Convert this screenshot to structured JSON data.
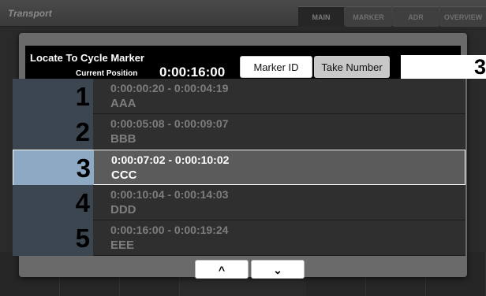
{
  "app": {
    "title": "Transport",
    "tabs": [
      "MAIN",
      "MARKER",
      "ADR",
      "OVERVIEW"
    ],
    "active_tab": "MAIN"
  },
  "dialog": {
    "title": "Locate To Cycle Marker",
    "current_position_label": "Current Position",
    "current_position_value": "0:00:16:00",
    "marker_id_label": "Marker ID",
    "take_number_label": "Take Number",
    "input_value": "3"
  },
  "markers": [
    {
      "id": "1",
      "range": "0:00:00:20 - 0:00:04:19",
      "name": "AAA",
      "selected": false
    },
    {
      "id": "2",
      "range": "0:00:05:08 - 0:00:09:07",
      "name": "BBB",
      "selected": false
    },
    {
      "id": "3",
      "range": "0:00:07:02 - 0:00:10:02",
      "name": "CCC",
      "selected": true
    },
    {
      "id": "4",
      "range": "0:00:10:04 - 0:00:14:03",
      "name": "DDD",
      "selected": false
    },
    {
      "id": "5",
      "range": "0:00:16:00 - 0:00:19:24",
      "name": "EEE",
      "selected": false
    }
  ],
  "scroll": {
    "up_icon": "^",
    "down_icon": "⌄"
  },
  "colors": {
    "selected_index": "#8ea9c3",
    "index_bg": "#3c4650",
    "row_bg": "#2f2f2f"
  }
}
